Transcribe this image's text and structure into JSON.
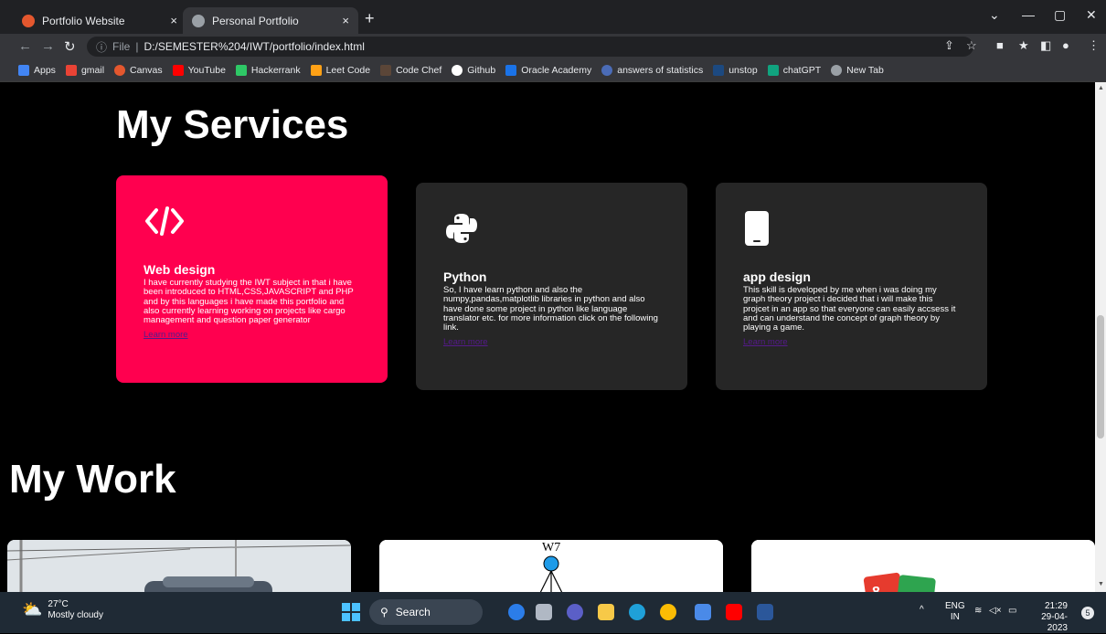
{
  "browser": {
    "tabs": [
      {
        "title": "Portfolio Website",
        "active": false
      },
      {
        "title": "Personal Portfolio",
        "active": true
      }
    ],
    "new_tab": "+",
    "close": "×",
    "url_prefix": "File",
    "url": "D:/SEMESTER%204/IWT/portfolio/index.html",
    "bookmarks": [
      {
        "label": "Apps",
        "color": "#4285f4"
      },
      {
        "label": "gmail",
        "color": "#ea4335"
      },
      {
        "label": "Canvas",
        "color": "#e4572e"
      },
      {
        "label": "YouTube",
        "color": "#ff0000"
      },
      {
        "label": "Hackerrank",
        "color": "#2ec866"
      },
      {
        "label": "Leet Code",
        "color": "#ffa116"
      },
      {
        "label": "Code Chef",
        "color": "#5b4638"
      },
      {
        "label": "Github",
        "color": "#ffffff"
      },
      {
        "label": "Oracle Academy",
        "color": "#1a73e8"
      },
      {
        "label": "answers of statistics",
        "color": "#4b6cb7"
      },
      {
        "label": "unstop",
        "color": "#1c4980"
      },
      {
        "label": "chatGPT",
        "color": "#10a37f"
      },
      {
        "label": "New Tab",
        "color": "#9aa0a6"
      }
    ]
  },
  "page": {
    "services_heading": "My Services",
    "work_heading": "My Work",
    "services": [
      {
        "icon": "code-icon",
        "title": "Web design",
        "text": "I have currently studying the IWT subject in that i have been introduced to HTML,CSS,JAVASCRIPT and PHP and by this languages i have made this portfolio and also currently learning working on projects like cargo management and question paper generator",
        "link": "Learn more",
        "accent": "#ff004f"
      },
      {
        "icon": "python-icon",
        "title": "Python",
        "text": "So, I have learn python and also the numpy,pandas,matplotlib libraries in python and also have done some project in python like language translator etc. for more information click on the following link.",
        "link": "Learn more"
      },
      {
        "icon": "mobile-icon",
        "title": "app design",
        "text": "This skill is developed by me when i was doing my graph theory project i decided that i will make this projcet in an app so that everyone can easily accsess it and can understand the concept of graph theory by playing a game.",
        "link": "Learn more"
      }
    ],
    "work_label_graph": "W7"
  },
  "taskbar": {
    "temperature": "27°C",
    "weather": "Mostly cloudy",
    "search": "Search",
    "lang_top": "ENG",
    "lang_bottom": "IN",
    "time": "21:29",
    "date": "29-04-2023",
    "notification_count": "5"
  }
}
